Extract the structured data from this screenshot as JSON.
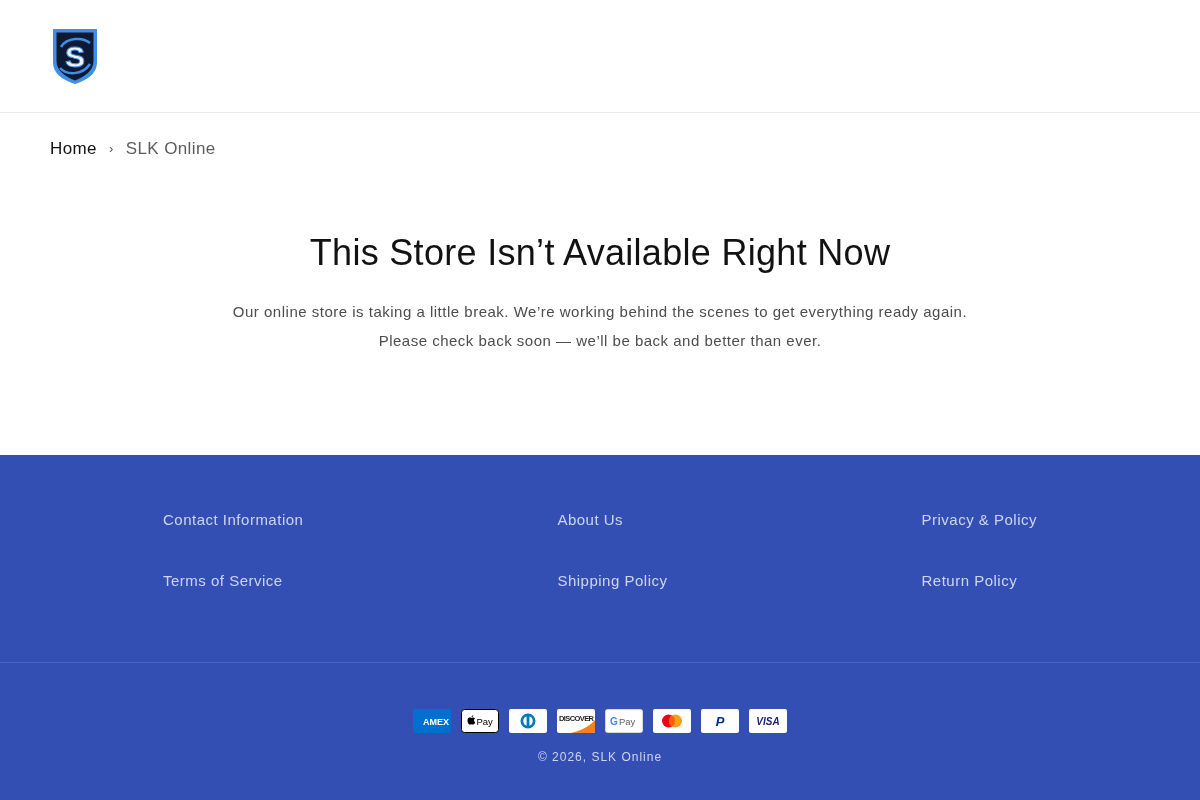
{
  "header": {
    "logo": {
      "letter": "S"
    }
  },
  "breadcrumb": {
    "items": [
      {
        "label": "Home"
      },
      {
        "label": "SLK Online"
      }
    ],
    "separator": "›"
  },
  "heading": "This Store Isn’t Available Right Now",
  "message": [
    "Our online store is taking a little break. We’re working behind the scenes to get everything ready again.",
    "Please check back soon — we’ll be back and better than ever."
  ],
  "footer": {
    "columns": [
      {
        "links": [
          "Contact Information",
          "Terms of Service"
        ]
      },
      {
        "links": [
          "About Us",
          "Shipping Policy"
        ]
      },
      {
        "links": [
          "Privacy & Policy",
          "Return Policy"
        ]
      }
    ],
    "payment_methods": [
      {
        "kind": "amex",
        "label": "AMEX"
      },
      {
        "kind": "applepay",
        "label": "Pay"
      },
      {
        "kind": "diners"
      },
      {
        "kind": "discover",
        "label": "DISCOVER"
      },
      {
        "kind": "googlepay",
        "mark": "G",
        "label": "Pay"
      },
      {
        "kind": "mastercard"
      },
      {
        "kind": "paypal",
        "label": "P"
      },
      {
        "kind": "visa",
        "label": "VISA"
      }
    ],
    "copyright": "© 2026, SLK Online"
  }
}
